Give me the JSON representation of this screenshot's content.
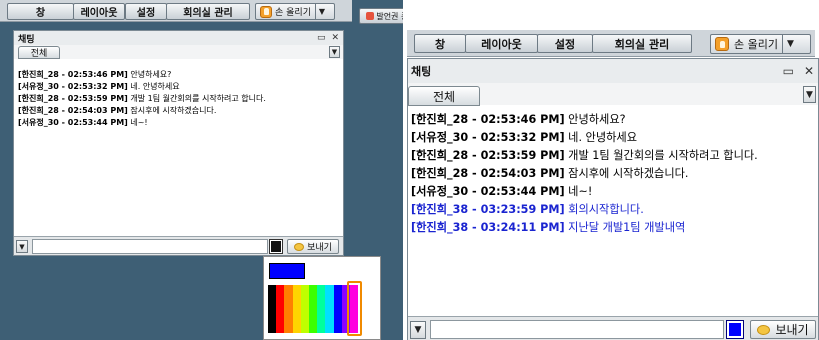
{
  "toolbar": {
    "window_label": "창",
    "layout_label": "레이아웃",
    "settings_label": "설정",
    "room_manage_label": "회의실 관리",
    "raise_hand_label": "손 올리기",
    "end_speech_label": "발언권 종료"
  },
  "chat": {
    "title": "채팅",
    "tab_all": "전체",
    "send_label": "보내기",
    "input_value": "",
    "messages_left": [
      {
        "who": "[한진희_28 - 02:53:46 PM]",
        "text": " 안녕하세요?"
      },
      {
        "who": "[서유정_30 - 02:53:32 PM]",
        "text": " 네. 안녕하세요"
      },
      {
        "who": "[한진희_28 - 02:53:59 PM]",
        "text": " 개발 1팀 월간회의를 시작하려고 합니다."
      },
      {
        "who": "[한진희_28 - 02:54:03 PM]",
        "text": " 잠시후에 시작하겠습니다."
      },
      {
        "who": "[서유정_30 - 02:53:44 PM]",
        "text": " 네~!"
      }
    ],
    "messages_right": [
      {
        "who": "[한진희_28 - 02:53:46 PM]",
        "text": " 안녕하세요?"
      },
      {
        "who": "[서유정_30 - 02:53:32 PM]",
        "text": " 네. 안녕하세요"
      },
      {
        "who": "[한진희_28 - 02:53:59 PM]",
        "text": " 개발 1팀 월간회의를 시작하려고 합니다."
      },
      {
        "who": "[한진희_28 - 02:54:03 PM]",
        "text": " 잠시후에 시작하겠습니다."
      },
      {
        "who": "[서유정_30 - 02:53:44 PM]",
        "text": " 네~!"
      },
      {
        "who": "[한진희_38 - 03:23:59 PM]",
        "text": " 회의시작합니다."
      },
      {
        "who": "[한진희_38 - 03:24:11 PM]",
        "text": " 지난달 개발1팀 개발내역"
      }
    ]
  },
  "palette": {
    "selected_color": "#0000ff",
    "colors": [
      "#000000",
      "#ff0000",
      "#ff7f00",
      "#ffd400",
      "#bfff00",
      "#3cff00",
      "#00ff9c",
      "#00e0ff",
      "#0000ff",
      "#8a00ff",
      "#ff00e0"
    ],
    "highlighted_index": 8
  },
  "colors": {
    "background": "#3e5f75",
    "own_message": "#1a24d0"
  }
}
